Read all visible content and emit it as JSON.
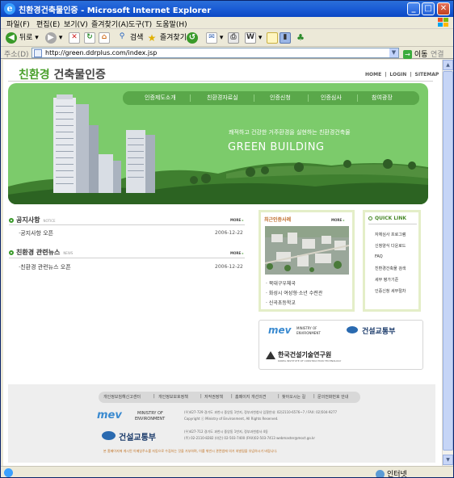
{
  "window": {
    "title": "친환경건축물인증 - Microsoft Internet Explorer",
    "minimize": "_",
    "maximize": "□",
    "close": "✕"
  },
  "menu": {
    "items": [
      "파일(F)",
      "편집(E)",
      "보기(V)",
      "즐겨찾기(A)",
      "도구(T)",
      "도움말(H)"
    ]
  },
  "toolbar": {
    "back": "뒤로",
    "search": "검색",
    "favorites": "즐겨찾기"
  },
  "address": {
    "label": "주소(D)",
    "url": "http://green.ddrplus.com/index.jsp",
    "go": "이동",
    "links": "연결"
  },
  "status": {
    "zone": "인터넷"
  },
  "site": {
    "logo_prefix": "친환경",
    "logo_suffix": " 건축물인증",
    "utility": [
      "HOME",
      "|",
      "LOGIN",
      "|",
      "SITEMAP"
    ],
    "nav": [
      "인증제도소개",
      "친환경자료실",
      "인증신청",
      "인증심사",
      "참여광장"
    ],
    "tagline": "쾌적하고 건강한 거주환경을 실현하는 친환경건축물",
    "headline": "GREEN BUILDING"
  },
  "notice": {
    "title": "공지사항",
    "subtitle": "NOTICE",
    "more": "MORE",
    "posts": [
      {
        "title": "·공지사항 오픈",
        "date": "2006-12-22"
      }
    ]
  },
  "news": {
    "title": "친환경 관련뉴스",
    "subtitle": "NEWS",
    "more": "MORE",
    "posts": [
      {
        "title": "·친환경 관련뉴스 오픈",
        "date": "2006-12-22"
      }
    ]
  },
  "recent": {
    "title": "최근인증사례",
    "more": "MORE",
    "items": [
      "· 북대구우체국",
      "· 화성시 여성형·소년 수련관",
      "· 신곡초등학교"
    ]
  },
  "quicklink": {
    "title": "QUICK LINK",
    "items": [
      "자체심사 프로그램",
      "신청양식 다운로드",
      "FAQ",
      "친환경건축물 검색",
      "세부 평가기준",
      "인증신청 세부절차"
    ]
  },
  "partners": {
    "mev_logo": "mev",
    "mev_text_1": "MINISTRY OF",
    "mev_text_2": "ENVIRONMENT",
    "moct": "건설교통부",
    "kict": "한국건설기술연구원",
    "kict_sub": "KOREA INSTITUTE OF CONSTRUCTION TECHNOLOGY"
  },
  "footer": {
    "links": [
      "개인정보침해신고센터",
      "|",
      "개인정보보호정책",
      "|",
      "저작권정책",
      "|",
      "홈페이지 개선의견",
      "|",
      "찾아오시는 길",
      "|",
      "문의전화번호 안내"
    ],
    "line1": "(우)427-729 경기도 과천시 중앙동 1번지, 정부과천청사   입찰안내: 02)2110-6576~7 / FAX: 02)504-9277",
    "line2": "Copyright ⓒ Ministry of Environment,  All Rights Reserved.",
    "line3": "(우)427-712 경기도 과천시 중앙동 1번지, 정부과천청사 4동",
    "line4": "(주) 02-2110-8282 (야간) 02-503-7400 (FAX)02-503-7413  webmaster@moct.go.kr",
    "notice": "본 홈페이지에 게시된 이메일주소를 자동으로 수집하는 것을 거부하며, 이를 위반시 관련법에 의거 처벌됨을 유념하시기 바랍니다.",
    "mev_logo": "mev",
    "mev_text_1": "MINISTRY OF",
    "mev_text_2": "ENVIRONMENT",
    "moct": "건설교통부"
  },
  "colors": {
    "brand_green": "#7ccb6b",
    "nav_green": "#5aa84a",
    "titlebar_blue": "#1c5ed6"
  }
}
